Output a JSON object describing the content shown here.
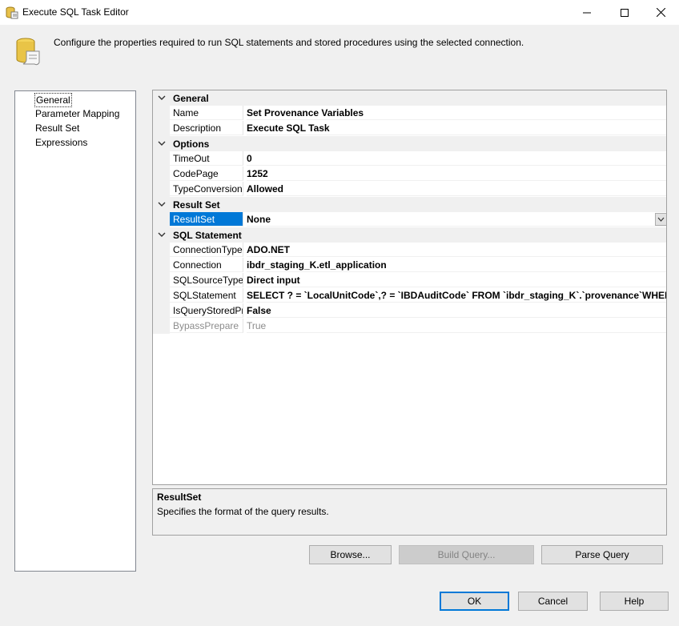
{
  "window": {
    "title": "Execute SQL Task Editor",
    "controls": {
      "minimize_icon": "minimize-icon",
      "maximize_icon": "maximize-icon",
      "close_icon": "close-icon"
    }
  },
  "header": {
    "icon": "database-scroll-icon",
    "text": "Configure the properties required to run SQL statements and stored procedures using the selected connection."
  },
  "nav": {
    "items": [
      {
        "label": "General",
        "selected": true
      },
      {
        "label": "Parameter Mapping"
      },
      {
        "label": "Result Set"
      },
      {
        "label": "Expressions"
      }
    ]
  },
  "grid": {
    "categories": {
      "general": "General",
      "options": "Options",
      "result_set": "Result Set",
      "sql_statement": "SQL Statement"
    },
    "props": {
      "name": {
        "name": "Name",
        "value": "Set Provenance Variables"
      },
      "description": {
        "name": "Description",
        "value": "Execute SQL Task"
      },
      "timeout": {
        "name": "TimeOut",
        "value": "0"
      },
      "codepage": {
        "name": "CodePage",
        "value": "1252"
      },
      "typeconversion": {
        "name": "TypeConversionMode",
        "value": "Allowed"
      },
      "resultset": {
        "name": "ResultSet",
        "value": "None"
      },
      "connectiontype": {
        "name": "ConnectionType",
        "value": "ADO.NET"
      },
      "connection": {
        "name": "Connection",
        "value": "ibdr_staging_K.etl_application"
      },
      "sqlsourcetype": {
        "name": "SQLSourceType",
        "value": "Direct input"
      },
      "sqlstatement": {
        "name": "SQLStatement",
        "value": "SELECT ? = `LocalUnitCode`,? = `IBDAuditCode` FROM `ibdr_staging_K`.`provenance`WHERE `Da"
      },
      "isquerystored": {
        "name": "IsQueryStoredProcedure",
        "value": "False"
      },
      "bypassprepare": {
        "name": "BypassPrepare",
        "value": "True"
      }
    }
  },
  "description_panel": {
    "title": "ResultSet",
    "text": "Specifies the format of the query results."
  },
  "buttons": {
    "browse": "Browse...",
    "build_query": "Build Query...",
    "parse_query": "Parse Query",
    "ok": "OK",
    "cancel": "Cancel",
    "help": "Help"
  },
  "colors": {
    "selection": "#0078d7",
    "category_bg": "#f0f0f0"
  }
}
